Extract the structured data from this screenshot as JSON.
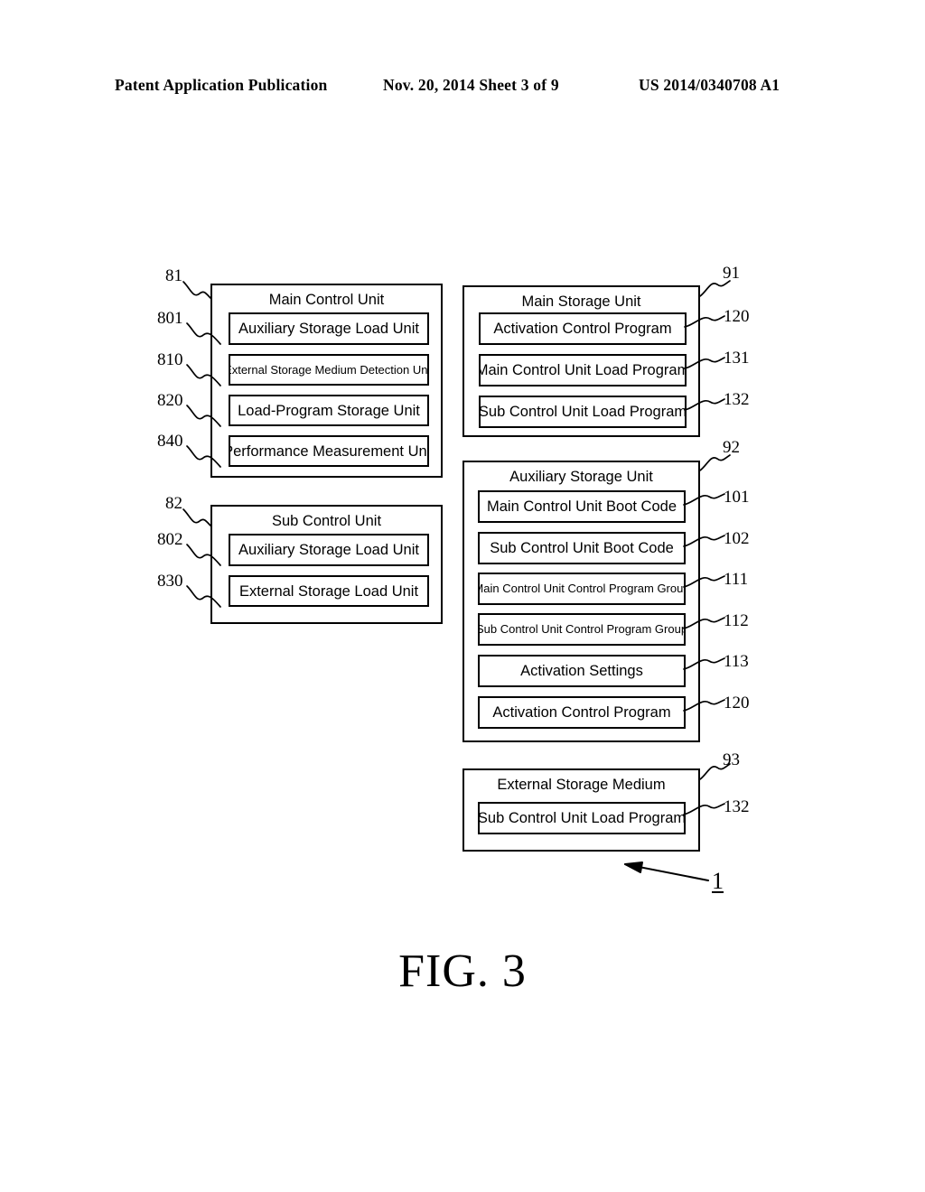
{
  "header": {
    "left": "Patent Application Publication",
    "middle": "Nov. 20, 2014  Sheet 3 of 9",
    "right": "US 2014/0340708 A1"
  },
  "figure": {
    "caption": "FIG. 3",
    "system_numeral": "1"
  },
  "blocks": {
    "main_control_unit": {
      "ref": "81",
      "title": "Main Control Unit",
      "items": [
        {
          "ref": "801",
          "label": "Auxiliary Storage Load Unit",
          "small": false
        },
        {
          "ref": "810",
          "label": "External Storage Medium Detection Unit",
          "small": true
        },
        {
          "ref": "820",
          "label": "Load-Program Storage Unit",
          "small": false
        },
        {
          "ref": "840",
          "label": "Performance Measurement Unit",
          "small": false
        }
      ]
    },
    "sub_control_unit": {
      "ref": "82",
      "title": "Sub Control Unit",
      "items": [
        {
          "ref": "802",
          "label": "Auxiliary Storage Load Unit",
          "small": false
        },
        {
          "ref": "830",
          "label": "External Storage Load Unit",
          "small": false
        }
      ]
    },
    "main_storage_unit": {
      "ref": "91",
      "title": "Main Storage Unit",
      "items": [
        {
          "ref": "120",
          "label": "Activation Control Program",
          "small": false
        },
        {
          "ref": "131",
          "label": "Main Control Unit Load Program",
          "small": false
        },
        {
          "ref": "132",
          "label": "Sub Control Unit Load Program",
          "small": false
        }
      ]
    },
    "auxiliary_storage_unit": {
      "ref": "92",
      "title": "Auxiliary Storage Unit",
      "items": [
        {
          "ref": "101",
          "label": "Main Control Unit Boot Code",
          "small": false
        },
        {
          "ref": "102",
          "label": "Sub Control Unit Boot Code",
          "small": false
        },
        {
          "ref": "111",
          "label": "Main Control Unit Control Program Group",
          "small": true
        },
        {
          "ref": "112",
          "label": "Sub Control Unit Control Program Group",
          "small": true
        },
        {
          "ref": "113",
          "label": "Activation Settings",
          "small": false
        },
        {
          "ref": "120",
          "label": "Activation Control Program",
          "small": false
        }
      ]
    },
    "external_storage_medium": {
      "ref": "93",
      "title": "External Storage Medium",
      "items": [
        {
          "ref": "132",
          "label": "Sub Control Unit Load Program",
          "small": false
        }
      ]
    }
  }
}
